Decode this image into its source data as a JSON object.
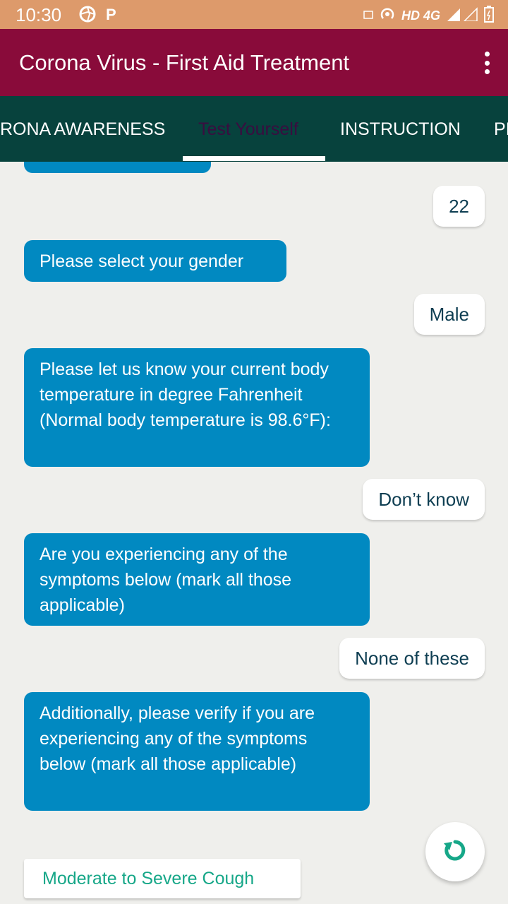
{
  "status_bar": {
    "time": "10:30",
    "icons": [
      "aperture-icon",
      "p-app-icon"
    ],
    "right_icons": [
      "cast-icon",
      "hotspot-icon",
      "signal-icon",
      "battery-icon"
    ],
    "network_label": "HD 4G"
  },
  "app_bar": {
    "title": "Corona Virus - First Aid Treatment",
    "menu_icon": "more-vert-icon"
  },
  "tabs": [
    {
      "label": "RONA AWARENESS",
      "active": false
    },
    {
      "label": "Test Yourself",
      "active": true
    },
    {
      "label": "INSTRUCTION",
      "active": false
    },
    {
      "label": "PI",
      "active": false
    }
  ],
  "chat": {
    "messages": [
      {
        "from": "user",
        "text": "22"
      },
      {
        "from": "bot",
        "text": "Please select your gender"
      },
      {
        "from": "user",
        "text": "Male"
      },
      {
        "from": "bot",
        "text": "Please let us know your current body temperature in degree Fahrenheit (Normal body temperature is 98.6°F):"
      },
      {
        "from": "user",
        "text": "Don’t know"
      },
      {
        "from": "bot",
        "text": "Are you experiencing any of the symptoms below (mark all those applicable)"
      },
      {
        "from": "user",
        "text": "None of these"
      },
      {
        "from": "bot",
        "text": "Additionally, please verify if you are experiencing any of the symptoms below (mark all those applicable)"
      }
    ],
    "option_label": "Moderate to Severe Cough",
    "fab_icon": "restart-icon"
  },
  "colors": {
    "status_bar": "#dd9a6b",
    "app_bar": "#890b3a",
    "tab_bar": "#07423d",
    "bot_bubble": "#0189c1",
    "option_text": "#16a788",
    "background": "#efefec"
  }
}
